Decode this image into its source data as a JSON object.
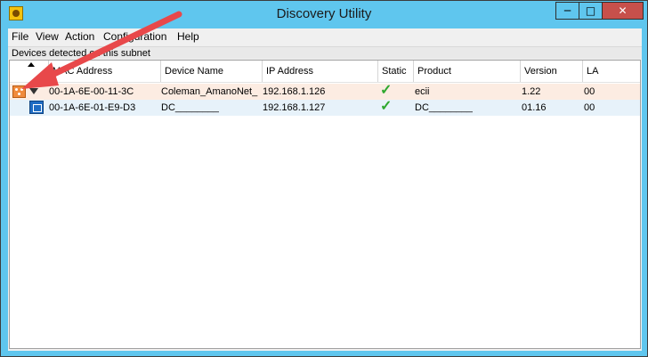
{
  "window": {
    "title": "Discovery Utility",
    "controls": {
      "minimize": "─",
      "maximize": "□",
      "close": "✕"
    }
  },
  "menu": [
    "File",
    "View",
    "Action",
    "Configuration",
    "Help"
  ],
  "subnet_label": "Devices detected on this subnet",
  "columns": [
    "MAC Address",
    "Device Name",
    "IP Address",
    "Static",
    "Product",
    "Version",
    "LA"
  ],
  "rows": [
    {
      "mac": "00-1A-6E-00-11-3C",
      "device_name": "Coleman_AmanoNet_",
      "ip": "192.168.1.126",
      "static": "✓",
      "product": "ecii",
      "version": "1.22",
      "la": "00"
    },
    {
      "mac": "00-1A-6E-01-E9-D3",
      "device_name": "DC________",
      "ip": "192.168.1.127",
      "static": "✓",
      "product": "DC________",
      "version": "01.16",
      "la": "00"
    }
  ],
  "annotation": {
    "color": "#e8484a"
  }
}
